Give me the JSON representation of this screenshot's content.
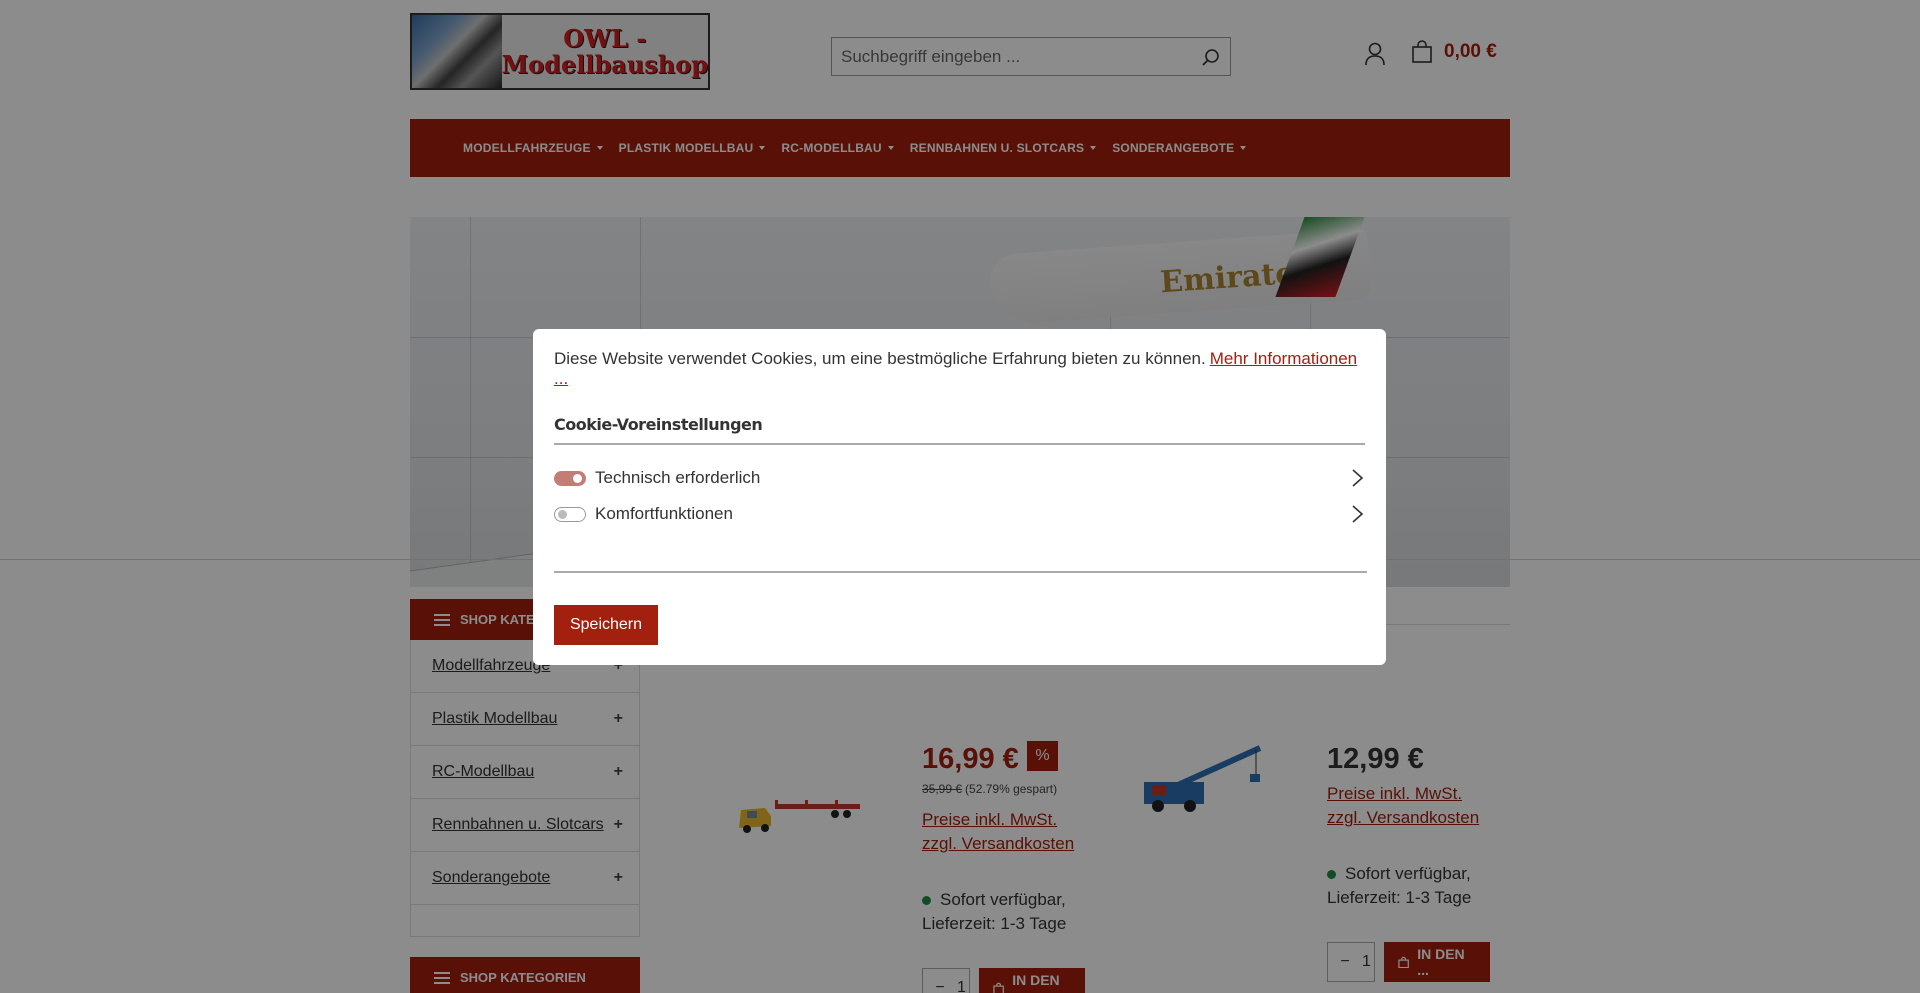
{
  "header": {
    "logo_line1": "OWL -",
    "logo_line2": "Modellbaushop",
    "search_placeholder": "Suchbegriff eingeben ...",
    "cart_total": "0,00 €"
  },
  "nav": {
    "items": [
      {
        "label": "MODELLFAHRZEUGE"
      },
      {
        "label": "PLASTIK MODELLBAU"
      },
      {
        "label": "RC-MODELLBAU"
      },
      {
        "label": "RENNBAHNEN U. SLOTCARS"
      },
      {
        "label": "SONDERANGEBOTE"
      }
    ]
  },
  "hero": {
    "plane_text": "Emirates"
  },
  "sidebar": {
    "title": "SHOP KATEGORIEN",
    "title_truncated": "SHOP KATEG",
    "items": [
      {
        "label": "Modellfahrzeuge"
      },
      {
        "label": "Plastik Modellbau"
      },
      {
        "label": "RC-Modellbau"
      },
      {
        "label": "Rennbahnen u. Slotcars"
      },
      {
        "label": "Sonderangebote"
      }
    ],
    "expand_symbol": "+"
  },
  "products": [
    {
      "price": "16,99 €",
      "badge": "%",
      "old_price": "35,99 €",
      "saving": "(52.79% gespart)",
      "tax_line1": "Preise inkl. MwSt.",
      "tax_line2": "zzgl. Versandkosten",
      "stock_line1": "Sofort verfügbar,",
      "stock_line2": "Lieferzeit: 1-3 Tage",
      "qty": "1",
      "cart_label": "IN DEN ..."
    },
    {
      "price": "12,99 €",
      "tax_line1": "Preise inkl. MwSt.",
      "tax_line2": "zzgl. Versandkosten",
      "stock_line1": "Sofort verfügbar,",
      "stock_line2": "Lieferzeit: 1-3 Tage",
      "qty": "1",
      "cart_label": "IN DEN ..."
    }
  ],
  "cookie": {
    "text": "Diese Website verwendet Cookies, um eine bestmögliche Erfahrung bieten zu können.",
    "more_link": "Mehr Informationen ...",
    "title": "Cookie-Voreinstellungen",
    "prefs": [
      {
        "label": "Technisch erforderlich",
        "enabled": true
      },
      {
        "label": "Komfortfunktionen",
        "enabled": false
      }
    ],
    "save_label": "Speichern"
  },
  "colors": {
    "brand": "#a3200e",
    "stock_dot": "#1e8a44"
  }
}
